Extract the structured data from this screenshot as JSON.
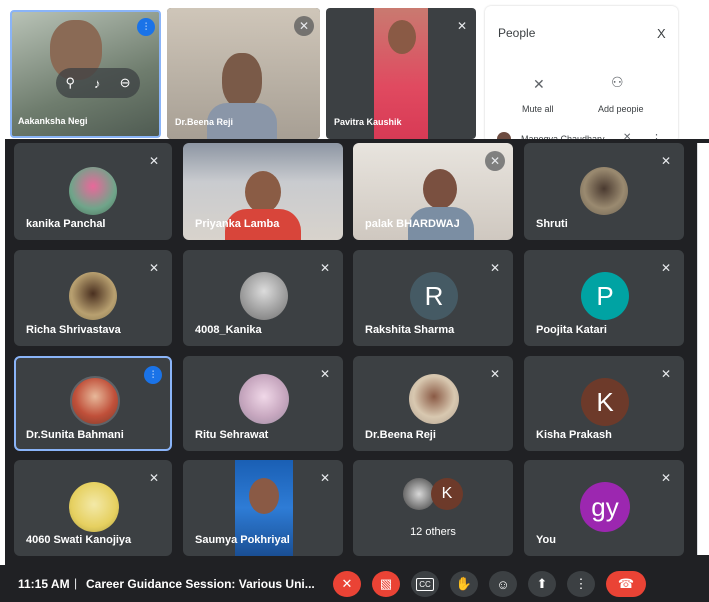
{
  "top_row": {
    "tiles": [
      {
        "name": "Aakanksha Negi"
      },
      {
        "name": "Dr.Beena Reji"
      },
      {
        "name": "Pavitra Kaushik"
      }
    ],
    "people_panel": {
      "title": "People",
      "close": "X",
      "mute_all": "Mute all",
      "add_people": "Add peopie",
      "first_person": "Manogya Chaudhary"
    }
  },
  "grid": [
    {
      "name": "kanika Panchal",
      "type": "photo"
    },
    {
      "name": "Priyanka Lamba",
      "type": "video"
    },
    {
      "name": "palak BHARDWAJ",
      "type": "video"
    },
    {
      "name": "Shruti",
      "type": "photo"
    },
    {
      "name": "Richa Shrivastava",
      "type": "photo"
    },
    {
      "name": "4008_Kanika",
      "type": "photo"
    },
    {
      "name": "Rakshita Sharma",
      "type": "letter",
      "letter": "R",
      "color": "#455a64"
    },
    {
      "name": "Poojita Katari",
      "type": "letter",
      "letter": "P",
      "color": "#00a3a3"
    },
    {
      "name": "Dr.Sunita Bahmani",
      "type": "photo",
      "speaking": true
    },
    {
      "name": "Ritu Sehrawat",
      "type": "photo"
    },
    {
      "name": "Dr.Beena Reji",
      "type": "photo"
    },
    {
      "name": "Kisha Prakash",
      "type": "letter",
      "letter": "K",
      "color": "#6d3a2a"
    },
    {
      "name": "4060 Swati Kanojiya",
      "type": "photo"
    },
    {
      "name": "Saumya Pokhriyal",
      "type": "video"
    },
    {
      "name": "12 others",
      "type": "others",
      "letter": "K"
    },
    {
      "name": "You",
      "type": "letter",
      "letter": "gy",
      "color": "#9c27b0"
    }
  ],
  "others_tile": {
    "label": "12 others",
    "avatar_letter": "K"
  },
  "bottom_bar": {
    "time": "11:15 AM",
    "separator": "|",
    "meeting_title": "Career Guidance Session: Various Uni...",
    "captions_label": "CC"
  },
  "colors": {
    "tile_bg": "#3c4043",
    "bar_bg": "#202124",
    "accent": "#1a73e8",
    "danger": "#ea4335"
  }
}
